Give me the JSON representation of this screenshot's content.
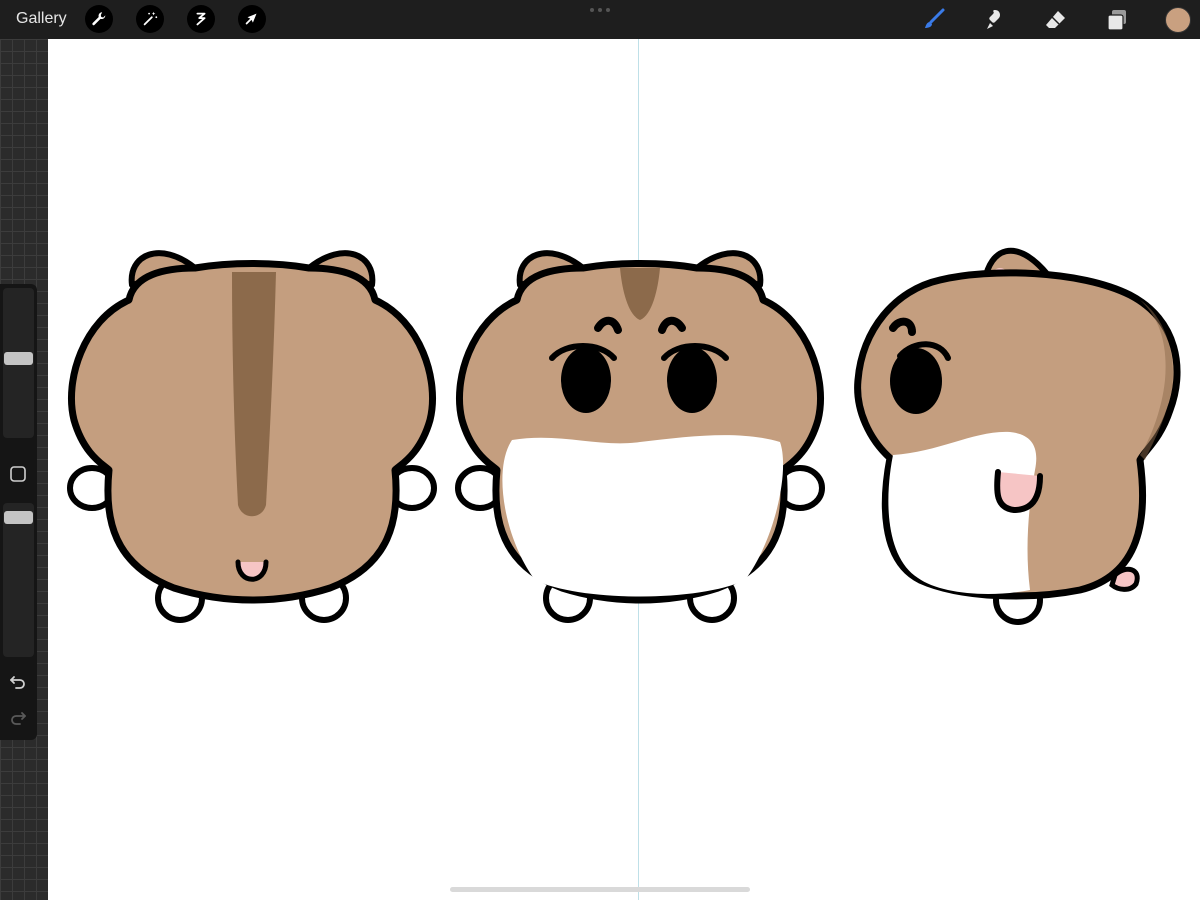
{
  "toolbar": {
    "gallery_label": "Gallery",
    "left_tools": [
      "wrench-icon",
      "magic-wand-icon",
      "selection-icon",
      "transform-arrow-icon"
    ],
    "right_tools": [
      "brush-icon",
      "smudge-icon",
      "eraser-icon",
      "layers-icon"
    ],
    "active_tool": "brush",
    "active_color": "#c9a080"
  },
  "sidebar": {
    "size_slider_value": 0.53,
    "opacity_slider_value": 0.05,
    "buttons": [
      "modify-square-icon",
      "undo-icon",
      "redo-icon"
    ]
  },
  "colors": {
    "fur": "#c49e7f",
    "stripe": "#8c6a4b",
    "belly": "#ffffff",
    "outline": "#000000",
    "pink": "#f6c5c5",
    "ui_dark": "#1e1e1e",
    "accent_blue": "#2a6ae0"
  },
  "artwork": {
    "subjects": [
      "hamster-back-view",
      "hamster-front-view",
      "hamster-side-view"
    ]
  }
}
